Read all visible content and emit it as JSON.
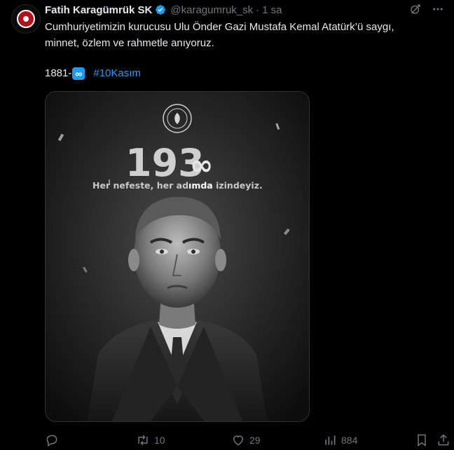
{
  "author": {
    "name": "Fatih Karagümrük SK",
    "handle": "@karagumruk_sk",
    "separator": "·",
    "time": "1 sa"
  },
  "tweet": {
    "line1": "Cumhuriyetimizin kurucusu Ulu Önder Gazi Mustafa Kemal Atatürk’ü saygı,",
    "line2": "minnet, özlem ve rahmetle anıyoruz.",
    "year_text": "1881-",
    "infinity": "∞",
    "hashtag": "#10Kasım"
  },
  "media": {
    "big_number": "193",
    "infinity": "∞",
    "slogan_part1": "Her nefeste, her ad",
    "slogan_bold": "ımda",
    "slogan_part2": " izindeyiz."
  },
  "actions": {
    "reply_count": "",
    "retweet_count": "10",
    "like_count": "29",
    "view_count": "884"
  },
  "icons": {
    "verified": "verified-badge-icon",
    "grok": "grok-icon",
    "more": "more-icon",
    "reply": "reply-icon",
    "retweet": "retweet-icon",
    "like": "heart-icon",
    "views": "views-icon",
    "bookmark": "bookmark-icon",
    "share": "share-icon"
  },
  "colors": {
    "background": "#000000",
    "text": "#e7e9ea",
    "muted": "#71767b",
    "accent": "#1d9bf0"
  }
}
